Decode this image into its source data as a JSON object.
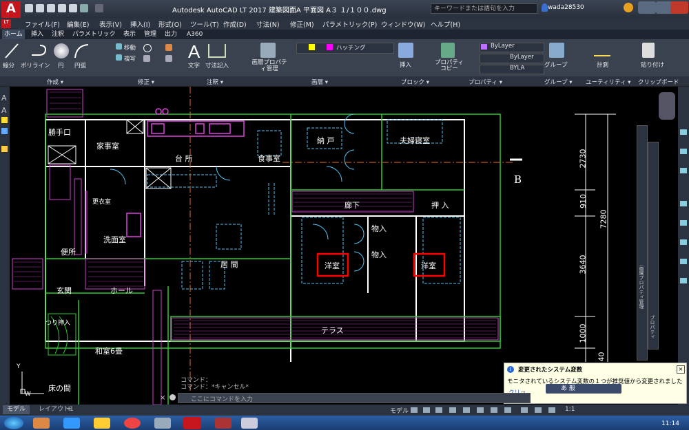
{
  "title": {
    "app_logo": "A",
    "logo_sub": "LT",
    "text": "Autodesk AutoCAD LT 2017    建築図面A  平面図  A３  １/１００.dwg",
    "search_placeholder": "キーワードまたは語句を入力",
    "user": "wada28530"
  },
  "menus": [
    "ファイル(F)",
    "編集(E)",
    "表示(V)",
    "挿入(I)",
    "形式(O)",
    "ツール(T)",
    "作成(D)",
    "寸法(N)",
    "修正(M)",
    "パラメトリック(P)",
    "ウィンドウ(W)",
    "ヘルプ(H)"
  ],
  "ribbon_tabs": [
    "ホーム",
    "挿入",
    "注釈",
    "パラメトリック",
    "表示",
    "管理",
    "出力",
    "A360"
  ],
  "ribbon": {
    "draw": [
      "線分",
      "ポリライン",
      "円",
      "円弧"
    ],
    "modify": [
      "移動",
      "複写"
    ],
    "annotation": [
      "文字",
      "寸法記入"
    ],
    "layer_props": "画層プロパティ管理",
    "hatch_label": "ハッチング",
    "block": "挿入",
    "props_copy": "プロパティコピー",
    "bylayer_color": "ByLayer",
    "bylayer_line": "ByLayer",
    "bylayer_weight": "BYLA",
    "group": "グループ",
    "measure": "計測",
    "paste": "貼り付け",
    "panels": [
      "作成 ▾",
      "修正 ▾",
      "注釈 ▾",
      "画層 ▾",
      "ブロック ▾",
      "プロパティ ▾",
      "グループ ▾",
      "ユーティリティ ▾",
      "クリップボード"
    ]
  },
  "rooms": {
    "katteguchi": "勝手口",
    "kajishitsu": "家事室",
    "daidokoro": "台 所",
    "shokujishitsu": "食事室",
    "nando": "納 戸",
    "fuufu": "夫婦寝室",
    "koishitsu": "更衣室",
    "senmen": "洗面室",
    "benjo": "便所",
    "genkan": "玄関",
    "hall": "ホール",
    "ima": "居 間",
    "rouka": "廊下",
    "oshiire": "押 入",
    "monoire1": "物入",
    "monoire2": "物入",
    "youshitsu1": "洋室",
    "youshitsu2": "洋室",
    "terrace": "テラス",
    "tsuri": "つり押入",
    "washitsu": "和室6畳",
    "tokonoma": "床の間",
    "b_label": "B"
  },
  "dims": [
    "2730",
    "910",
    "7280",
    "3640",
    "1000",
    "40"
  ],
  "palette_label": "画層プロパティ管理",
  "palette_label2": "プロパティ",
  "ucs": {
    "y": "Y",
    "w": "W"
  },
  "command": {
    "history1": "コマンド：",
    "history2": "コマンド：*キャンセル*",
    "placeholder": "ここにコマンドを入力"
  },
  "notification": {
    "title": "変更されたシステム変数",
    "body": "モニタされているシステム変数の１つが推奨値から変更されました",
    "link": "クリッ",
    "ime": "あ 般"
  },
  "layout_tabs": [
    "モデル",
    "レイアウト1",
    "+"
  ],
  "status": {
    "model": "モデル",
    "scale": "1:1"
  },
  "clock": "11:14",
  "colors": {
    "accent": "#c4161c",
    "canvas": "#000000",
    "red_box": "#ff0000"
  }
}
